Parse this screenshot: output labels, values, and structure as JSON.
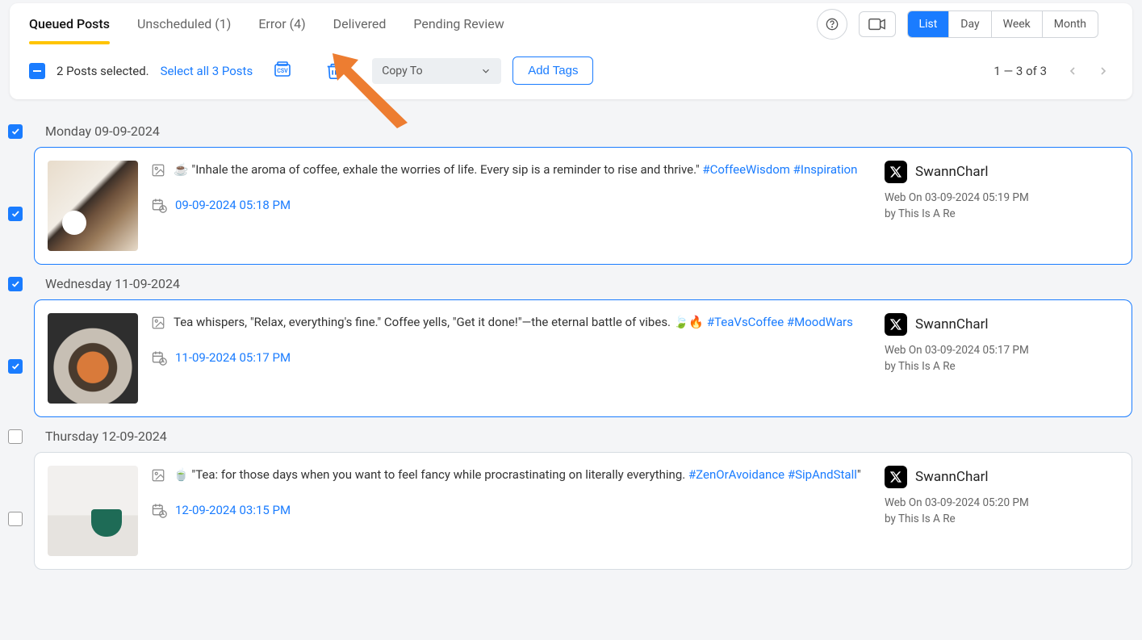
{
  "tabs": {
    "queued": "Queued Posts",
    "unscheduled": "Unscheduled  (1)",
    "error": "Error  (4)",
    "delivered": "Delivered",
    "pending": "Pending Review"
  },
  "viewSeg": {
    "list": "List",
    "day": "Day",
    "week": "Week",
    "month": "Month"
  },
  "selection": {
    "countText": "2 Posts selected.",
    "selectAll": "Select all 3 Posts",
    "copyTo": "Copy To",
    "addTags": "Add Tags",
    "pageRange": "1 — 3 of 3"
  },
  "groups": [
    {
      "dateLabel": "Monday 09-09-2024",
      "dateChecked": true,
      "sideChecked": true,
      "selected": true,
      "thumbClass": "t1",
      "emoji": "☕",
      "textBefore": "\"Inhale the aroma of coffee, exhale the worries of life. Every sip is a reminder to rise and thrive.\" ",
      "hashtags": "#CoffeeWisdom #Inspiration",
      "textAfter": "",
      "schedule": "09-09-2024 05:18 PM",
      "account": "SwannCharl",
      "meta1": "Web On 03-09-2024 05:19 PM",
      "meta2": "by This Is A Re"
    },
    {
      "dateLabel": "Wednesday 11-09-2024",
      "dateChecked": true,
      "sideChecked": true,
      "selected": true,
      "thumbClass": "t2",
      "emoji": "",
      "textBefore": "Tea whispers, \"Relax, everything's fine.\" Coffee yells, \"Get it done!\"—the eternal battle of vibes. 🍃🔥 ",
      "hashtags": "#TeaVsCoffee #MoodWars",
      "textAfter": "",
      "schedule": "11-09-2024 05:17 PM",
      "account": "SwannCharl",
      "meta1": "Web On 03-09-2024 05:17 PM",
      "meta2": "by This Is A Re"
    },
    {
      "dateLabel": "Thursday 12-09-2024",
      "dateChecked": false,
      "sideChecked": false,
      "selected": false,
      "thumbClass": "t3",
      "emoji": "🍵",
      "textBefore": "\"Tea: for those days when you want to feel fancy while procrastinating on literally everything. ",
      "hashtags": "#ZenOrAvoidance #SipAndStall",
      "textAfter": "\"",
      "schedule": "12-09-2024 03:15 PM",
      "account": "SwannCharl",
      "meta1": "Web On 03-09-2024 05:20 PM",
      "meta2": "by This Is A Re"
    }
  ]
}
